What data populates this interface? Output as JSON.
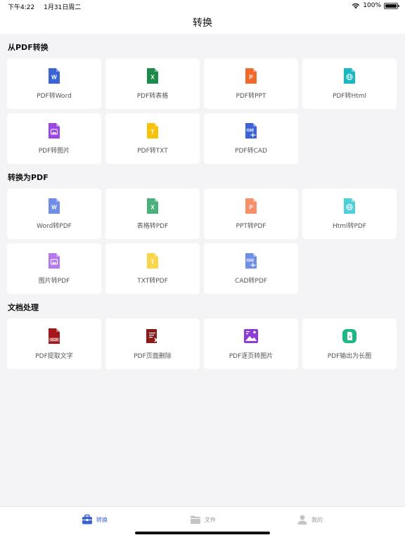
{
  "status_bar": {
    "time": "下午4:22",
    "date": "1月31日周二",
    "battery": "100%"
  },
  "nav": {
    "title": "转换"
  },
  "sections": [
    {
      "title": "从PDF转换",
      "items": [
        {
          "label": "PDF转Word",
          "icon": "word-file-icon",
          "color": "#3b63d6",
          "glyph": "W"
        },
        {
          "label": "PDF转表格",
          "icon": "excel-file-icon",
          "color": "#1b8a4b",
          "glyph": "X"
        },
        {
          "label": "PDF转PPT",
          "icon": "ppt-file-icon",
          "color": "#f26a2b",
          "glyph": "P"
        },
        {
          "label": "PDF转Html",
          "icon": "html-file-icon",
          "color": "#17b8c4",
          "glyph": "globe"
        },
        {
          "label": "PDF转图片",
          "icon": "image-file-icon",
          "color": "#9b45e4",
          "glyph": "img"
        },
        {
          "label": "PDF转TXT",
          "icon": "txt-file-icon",
          "color": "#f5c20c",
          "glyph": "T"
        },
        {
          "label": "PDF转CAD",
          "icon": "cad-file-icon",
          "color": "#3b63d6",
          "glyph": "CAD"
        }
      ]
    },
    {
      "title": "转换为PDF",
      "items": [
        {
          "label": "Word转PDF",
          "icon": "word-file-icon",
          "color": "#6f8fe6",
          "glyph": "W"
        },
        {
          "label": "表格转PDF",
          "icon": "excel-file-icon",
          "color": "#4bb07c",
          "glyph": "X"
        },
        {
          "label": "PPT转PDF",
          "icon": "ppt-file-icon",
          "color": "#f5906a",
          "glyph": "P"
        },
        {
          "label": "Html转PDF",
          "icon": "html-file-icon",
          "color": "#4fd0d8",
          "glyph": "globe"
        },
        {
          "label": "图片转PDF",
          "icon": "image-file-icon",
          "color": "#b47ae9",
          "glyph": "img"
        },
        {
          "label": "TXT转PDF",
          "icon": "txt-file-icon",
          "color": "#f8d54a",
          "glyph": "T"
        },
        {
          "label": "CAD转PDF",
          "icon": "cad-file-icon",
          "color": "#6f8fe6",
          "glyph": "CAD"
        }
      ]
    },
    {
      "title": "文档处理",
      "items": [
        {
          "label": "PDF提取文字",
          "icon": "ocr-icon",
          "color": "#a4161a",
          "glyph": "OCR"
        },
        {
          "label": "PDF页面删除",
          "icon": "page-delete-icon",
          "color": "#8b1a1a",
          "glyph": "del"
        },
        {
          "label": "PDF逐页转图片",
          "icon": "page-to-image-icon",
          "color": "#8e3ad6",
          "glyph": "pimg"
        },
        {
          "label": "PDF输出为长图",
          "icon": "long-image-icon",
          "color": "#1db885",
          "glyph": "long"
        }
      ]
    }
  ],
  "tabs": [
    {
      "label": "转换",
      "icon": "briefcase-icon",
      "active": true
    },
    {
      "label": "文件",
      "icon": "folder-icon",
      "active": false
    },
    {
      "label": "我的",
      "icon": "person-icon",
      "active": false
    }
  ],
  "colors": {
    "accent": "#3b63d6",
    "inactive": "#b0b0b0"
  }
}
